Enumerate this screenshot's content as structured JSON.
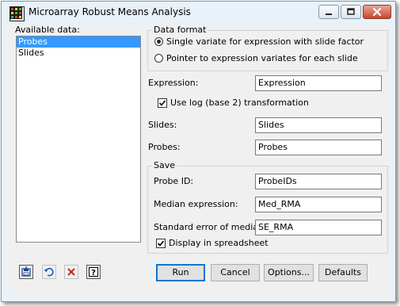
{
  "window": {
    "title": "Microarray Robust Means Analysis"
  },
  "available_data": {
    "label": "Available data:",
    "items": [
      "Probes",
      "Slides"
    ],
    "selected": "Probes"
  },
  "data_format": {
    "title": "Data format",
    "options": [
      "Single variate for expression with slide factor",
      "Pointer to expression variates for each slide"
    ],
    "selected_index": 0
  },
  "expression": {
    "label": "Expression:",
    "value": "Expression"
  },
  "log_transform": {
    "label": "Use log (base 2) transformation",
    "checked": true
  },
  "slides": {
    "label": "Slides:",
    "value": "Slides"
  },
  "probes": {
    "label": "Probes:",
    "value": "Probes"
  },
  "save": {
    "title": "Save",
    "probe_id": {
      "label": "Probe ID:",
      "value": "ProbeIDs"
    },
    "median_expression": {
      "label": "Median expression:",
      "value": "Med_RMA"
    },
    "std_error": {
      "label": "Standard error of median:",
      "value": "SE_RMA"
    },
    "display_in_spreadsheet": {
      "label": "Display in spreadsheet",
      "checked": true
    }
  },
  "buttons": {
    "run": "Run",
    "cancel": "Cancel",
    "options": "Options...",
    "defaults": "Defaults"
  },
  "icons": {
    "app": "microarray-grid-icon",
    "toolbar": [
      "save-pin-icon",
      "undo-icon",
      "clear-icon",
      "help-icon"
    ]
  }
}
